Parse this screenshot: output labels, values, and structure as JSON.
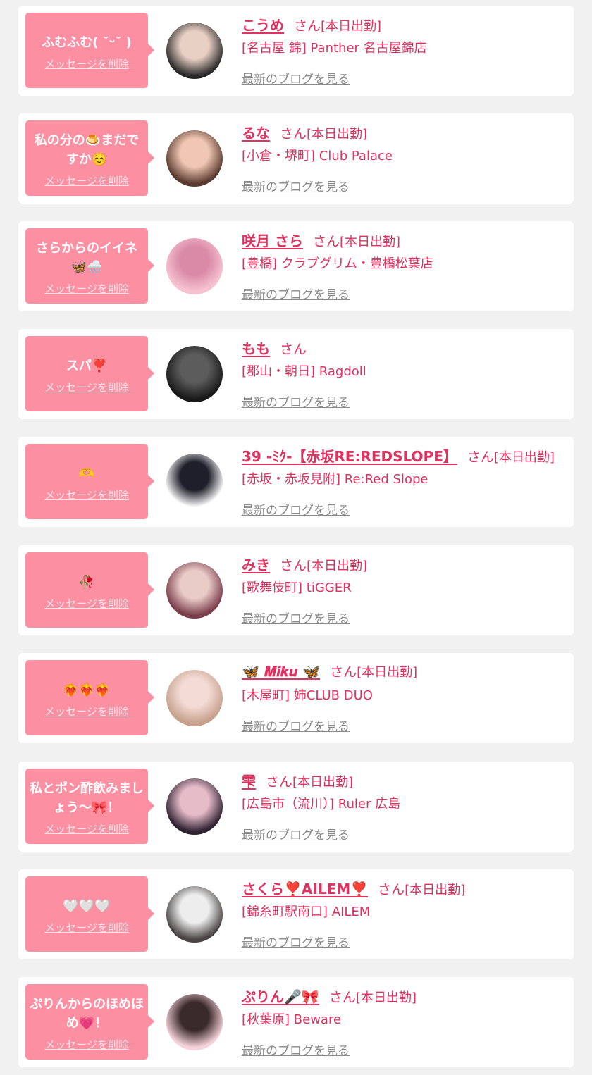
{
  "items": [
    {
      "message": "ふむふむ( ˘ᵕ˘ )",
      "delete": "メッセージを削除",
      "name": "こうめ",
      "san": "さん",
      "status": "[本日出勤]",
      "shop": "[名古屋 錦] Panther 名古屋錦店",
      "blog": "最新のブログを見る",
      "avatar_colors": [
        "#2b2b2b",
        "#e8d0c4"
      ]
    },
    {
      "message": "私の分の🍮まだですか☺️",
      "delete": "メッセージを削除",
      "name": "るな",
      "san": "さん",
      "status": "[本日出勤]",
      "shop": "[小倉・堺町] Club Palace",
      "blog": "最新のブログを見る",
      "avatar_colors": [
        "#5a3a2e",
        "#f0c7b4"
      ]
    },
    {
      "message": "さらからのイイネ🦋🌧️",
      "delete": "メッセージを削除",
      "name": "咲月 さら",
      "san": "さん",
      "status": "[本日出勤]",
      "shop": "[豊橋] クラブグリム・豊橋松葉店",
      "blog": "最新のブログを見る",
      "avatar_colors": [
        "#f7c3d3",
        "#d98aa6"
      ]
    },
    {
      "message": "スパ❣️",
      "delete": "メッセージを削除",
      "name": "もも",
      "san": "さん",
      "status": "",
      "shop": "[郡山・朝日] Ragdoll",
      "blog": "最新のブログを見る",
      "avatar_colors": [
        "#1a1a1a",
        "#5c5c5c"
      ]
    },
    {
      "message": "🫶",
      "delete": "メッセージを削除",
      "name": "39 -ﾐｸ-【赤坂RE:REDSLOPE】",
      "san": "さん",
      "status": "[本日出勤]",
      "shop": "[赤坂・赤坂見附] Re:Red Slope",
      "blog": "最新のブログを見る",
      "avatar_colors": [
        "#ffffff",
        "#1f1f2b"
      ]
    },
    {
      "message": "🥀",
      "delete": "メッセージを削除",
      "name": "みき",
      "san": "さん",
      "status": "[本日出勤]",
      "shop": "[歌舞伎町] tiGGER",
      "blog": "最新のブログを見る",
      "avatar_colors": [
        "#7a3d4c",
        "#e9cbc7"
      ]
    },
    {
      "message": "❤️‍🔥❤️‍🔥❤️‍🔥",
      "delete": "メッセージを削除",
      "name": "🦋 𝑴𝒊𝒌𝒖 🦋",
      "san": "さん",
      "status": "[本日出勤]",
      "shop": "[木屋町] 姉CLUB DUO",
      "blog": "最新のブログを見る",
      "avatar_colors": [
        "#c7a08c",
        "#f3dcd5"
      ]
    },
    {
      "message": "私とポン酢飲みましょう〜🎀！",
      "delete": "メッセージを削除",
      "name": "雫",
      "san": "さん",
      "status": "[本日出勤]",
      "shop": "[広島市（流川）] Ruler 広島",
      "blog": "最新のブログを見る",
      "avatar_colors": [
        "#2f2231",
        "#e7bcc9"
      ]
    },
    {
      "message": "🤍🤍🤍",
      "delete": "メッセージを削除",
      "name": "さくら❣️AILEM❣️",
      "san": "さん",
      "status": "[本日出勤]",
      "shop": "[錦糸町駅南口] AILEM",
      "blog": "最新のブログを見る",
      "avatar_colors": [
        "#4a4444",
        "#ededed"
      ]
    },
    {
      "message": "ぷりんからのほめほめ💗！",
      "delete": "メッセージを削除",
      "name": "ぷりん🎤🎀",
      "san": "さん",
      "status": "[本日出勤]",
      "shop": "[秋葉原] Beware",
      "blog": "最新のブログを見る",
      "avatar_colors": [
        "#f6d2da",
        "#3a2a2a"
      ]
    }
  ]
}
